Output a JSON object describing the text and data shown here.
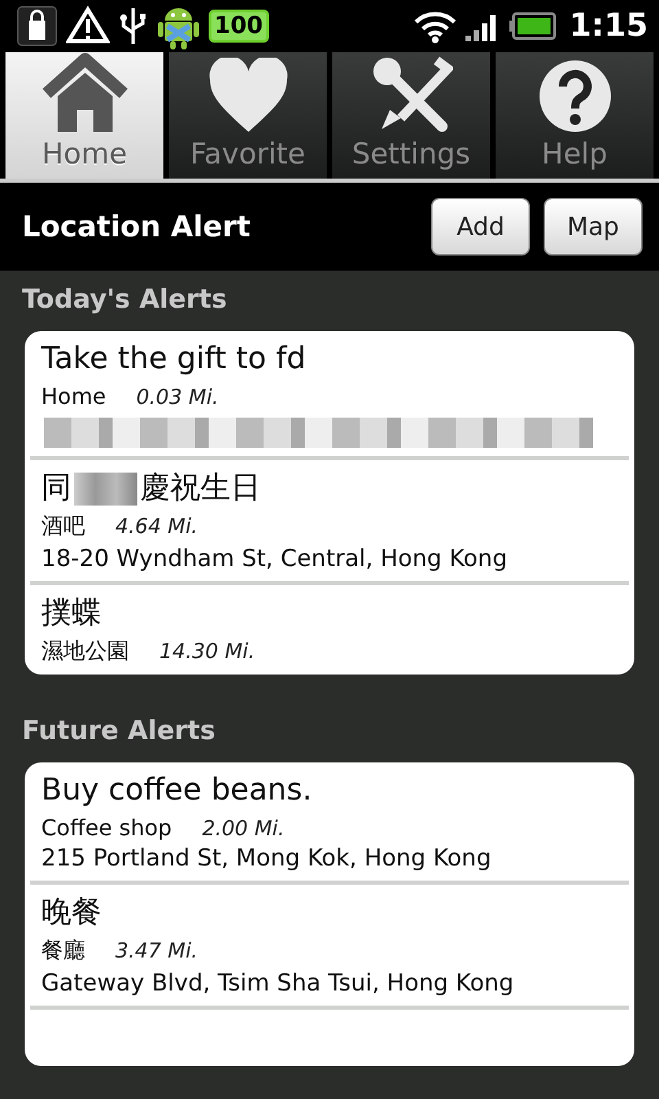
{
  "status_bar": {
    "battery_badge": "100",
    "time": "1:15"
  },
  "tabs": [
    {
      "label": "Home",
      "selected": true
    },
    {
      "label": "Favorite",
      "selected": false
    },
    {
      "label": "Settings",
      "selected": false
    },
    {
      "label": "Help",
      "selected": false
    }
  ],
  "header": {
    "title": "Location Alert",
    "buttons": [
      "Add",
      "Map"
    ]
  },
  "sections": [
    {
      "title": "Today's Alerts",
      "alerts": [
        {
          "title_parts": [
            "Take the gift to fd"
          ],
          "place": "Home",
          "distance": "0.03 Mi.",
          "address_redacted": true
        },
        {
          "title_parts": [
            "同",
            "慶祝生日"
          ],
          "place": "酒吧",
          "distance": "4.64 Mi.",
          "address": "18-20 Wyndham St, Central, Hong Kong"
        },
        {
          "title_parts": [
            "撲蝶"
          ],
          "place": "濕地公園",
          "distance": "14.30 Mi."
        }
      ]
    },
    {
      "title": "Future Alerts",
      "alerts": [
        {
          "title_parts": [
            "Buy coffee beans."
          ],
          "place": "Coffee shop",
          "distance": "2.00 Mi.",
          "address": "215 Portland St, Mong Kok, Hong Kong"
        },
        {
          "title_parts": [
            "晚餐"
          ],
          "place": "餐廳",
          "distance": "3.47 Mi.",
          "address": "Gateway Blvd, Tsim Sha Tsui, Hong Kong"
        }
      ]
    }
  ]
}
